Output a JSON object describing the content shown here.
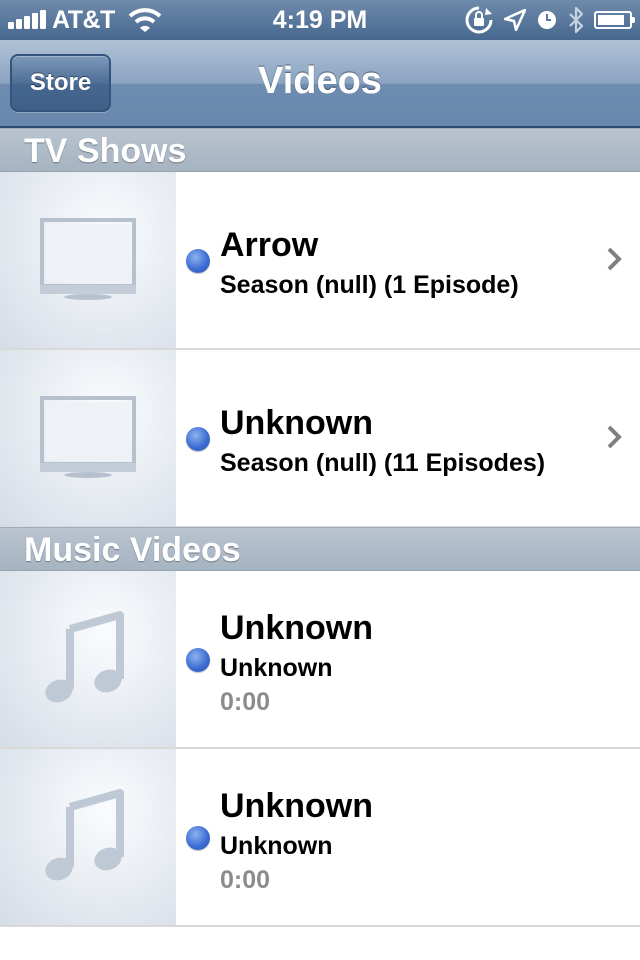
{
  "status_bar": {
    "carrier": "AT&T",
    "time": "4:19 PM",
    "battery_fraction": 0.85
  },
  "nav": {
    "store_label": "Store",
    "title": "Videos"
  },
  "sections": {
    "tv_shows": {
      "header": "TV Shows",
      "items": [
        {
          "title": "Arrow",
          "subtitle": "Season (null) (1 Episode)",
          "icon": "tv-icon"
        },
        {
          "title": "Unknown",
          "subtitle": "Season (null) (11 Episodes)",
          "icon": "tv-icon"
        }
      ]
    },
    "music_videos": {
      "header": "Music Videos",
      "items": [
        {
          "title": "Unknown",
          "subtitle": "Unknown",
          "duration": "0:00",
          "icon": "music-note-icon"
        },
        {
          "title": "Unknown",
          "subtitle": "Unknown",
          "duration": "0:00",
          "icon": "music-note-icon"
        }
      ]
    }
  },
  "colors": {
    "unplayed_dot": "#3f6fd4",
    "nav_bar": "#7c97b8",
    "section_header": "#aebac7"
  }
}
